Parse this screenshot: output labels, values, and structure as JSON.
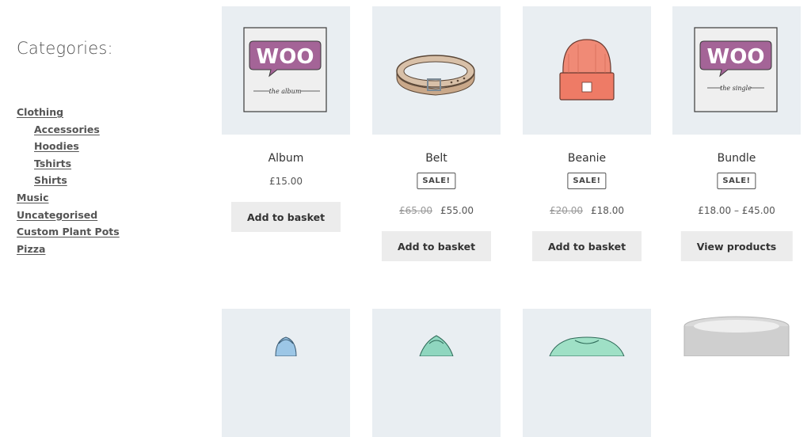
{
  "sidebar": {
    "title": "Categories:",
    "categories": [
      {
        "label": "Clothing"
      },
      {
        "label": "Accessories"
      },
      {
        "label": "Hoodies"
      },
      {
        "label": "Tshirts"
      },
      {
        "label": "Shirts"
      },
      {
        "label": "Music"
      },
      {
        "label": "Uncategorised"
      },
      {
        "label": "Custom Plant Pots"
      },
      {
        "label": "Pizza"
      }
    ]
  },
  "products": [
    {
      "name": "Album",
      "price": "£15.00",
      "button": "Add to basket",
      "image_icon": "woo-album-cover",
      "image_text": "WOO",
      "image_caption": "the album"
    },
    {
      "name": "Belt",
      "sale_badge": "SALE!",
      "old_price": "£65.00",
      "price": "£55.00",
      "button": "Add to basket",
      "image_icon": "belt"
    },
    {
      "name": "Beanie",
      "sale_badge": "SALE!",
      "old_price": "£20.00",
      "price": "£18.00",
      "button": "Add to basket",
      "image_icon": "beanie"
    },
    {
      "name": "Bundle",
      "sale_badge": "SALE!",
      "price": "£18.00 – £45.00",
      "button": "View products",
      "image_icon": "woo-single-cover",
      "image_text": "WOO",
      "image_caption": "the single"
    }
  ],
  "second_row": [
    {
      "image_icon": "hoodie-with-cap"
    },
    {
      "image_icon": "hoodie"
    },
    {
      "image_icon": "long-sleeve-tee"
    },
    {
      "image_icon": "plant-pot"
    }
  ]
}
